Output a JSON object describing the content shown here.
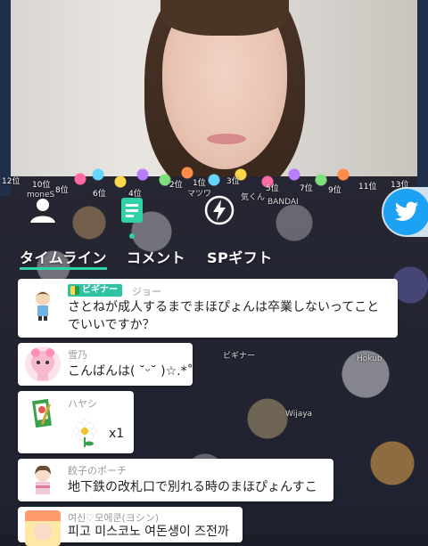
{
  "colors": {
    "accent": "#2fd3a6",
    "badge": "#2fc3a4",
    "twitter": "#1da1f2"
  },
  "ranks": [
    "12位",
    "10位",
    "8位",
    "6位",
    "4位",
    "2位",
    "1位",
    "3位",
    "5位",
    "7位",
    "9位",
    "11位",
    "13位"
  ],
  "bg_snippets": [
    "moneS",
    "BANDAI",
    "マツワ",
    "気くん",
    "ビギナー",
    "Hokub",
    "Wijaya"
  ],
  "tabs": {
    "icons": [
      "person-icon",
      "timeline-icon",
      "lightning-icon"
    ],
    "labels": [
      "タイムライン",
      "コメント",
      "SPギフト"
    ],
    "active_index": 0
  },
  "comments": [
    {
      "type": "comment",
      "badge": "ビギナー",
      "user": "ジョー",
      "text_line1": "さとねが成人するまでまほぴょんは卒業しないってこと",
      "text_line2": "でいいですか？"
    },
    {
      "type": "comment",
      "user": "雪乃",
      "text": "こんばんは( ˘ᵕ˘ )☆.*˚"
    },
    {
      "type": "gift",
      "user": "ハヤシ",
      "gift_icon": "flower-icon",
      "count": "x1"
    },
    {
      "type": "comment",
      "user": "餃子のポーチ",
      "text": "地下鉄の改札口で別れる時のまほぴょんすこ"
    },
    {
      "type": "comment",
      "user": "여신♡모에쿤(ヨシン)",
      "text": "피고 미스코노 여돈생이 즈전까"
    }
  ]
}
